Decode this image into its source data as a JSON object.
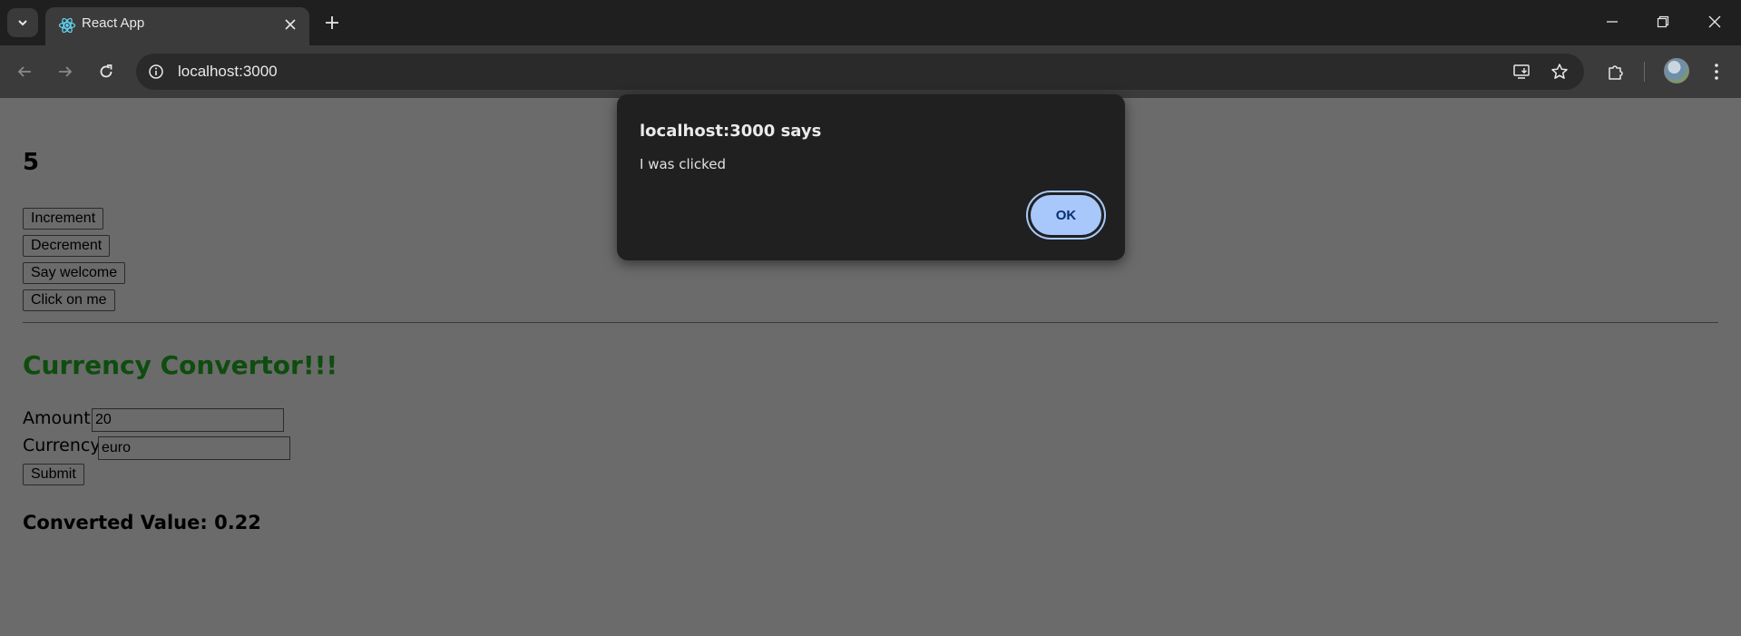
{
  "browser": {
    "tab": {
      "title": "React App",
      "favicon": "react-logo-icon"
    },
    "url": "localhost:3000",
    "icons": {
      "tab_search": "chevron-down-icon",
      "tab_close": "close-icon",
      "new_tab": "plus-icon",
      "minimize": "minimize-icon",
      "restore": "restore-icon",
      "close_window": "close-icon",
      "back": "back-arrow-icon",
      "forward": "forward-arrow-icon",
      "reload": "reload-icon",
      "site_info": "info-icon",
      "install": "install-app-icon",
      "bookmark": "star-icon",
      "extensions": "puzzle-icon",
      "profile": "avatar-icon",
      "menu": "kebab-menu-icon"
    }
  },
  "page": {
    "count": "5",
    "buttons": {
      "increment": "Increment",
      "decrement": "Decrement",
      "say_welcome": "Say welcome",
      "click_on_me": "Click on me"
    },
    "currency": {
      "title": "Currency Convertor!!!",
      "amount_label": "Amount:",
      "amount_value": "20",
      "currency_label": "Currency:",
      "currency_value": "euro",
      "submit_label": "Submit",
      "result_text": "Converted Value: 0.22"
    }
  },
  "dialog": {
    "title": "localhost:3000 says",
    "message": "I was clicked",
    "ok_label": "OK"
  },
  "colors": {
    "title_green": "#0e4d0e",
    "ok_button": "#a8c7fa",
    "dialog_bg": "#202020"
  }
}
